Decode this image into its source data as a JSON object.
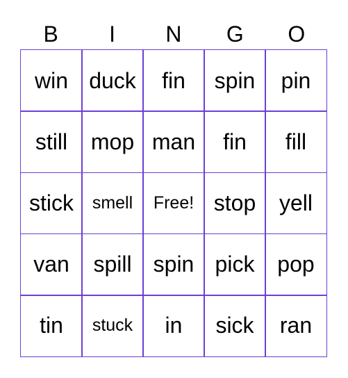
{
  "header": {
    "letters": [
      "B",
      "I",
      "N",
      "G",
      "O"
    ]
  },
  "theme": {
    "border_color": "#6b3fd6"
  },
  "grid": {
    "rows": [
      [
        "win",
        "duck",
        "fin",
        "spin",
        "pin"
      ],
      [
        "still",
        "mop",
        "man",
        "fin",
        "fill"
      ],
      [
        "stick",
        "smell",
        "Free!",
        "stop",
        "yell"
      ],
      [
        "van",
        "spill",
        "spin",
        "pick",
        "pop"
      ],
      [
        "tin",
        "stuck",
        "in",
        "sick",
        "ran"
      ]
    ]
  }
}
